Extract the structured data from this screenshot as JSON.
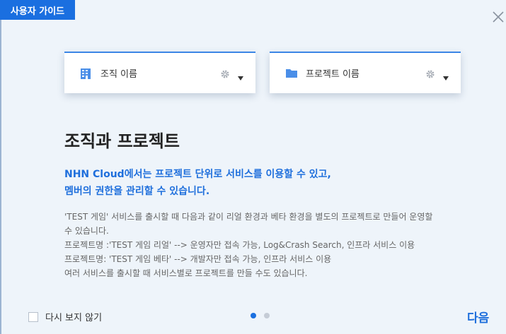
{
  "guide_tab": {
    "label": "사용자 가이드"
  },
  "cards": [
    {
      "label": "조직 이름",
      "icon": "building-icon"
    },
    {
      "label": "프로젝트 이름",
      "icon": "folder-icon"
    }
  ],
  "heading": "조직과 프로젝트",
  "lead": [
    "NHN Cloud에서는 프로젝트 단위로 서비스를 이용할 수 있고,",
    "멤버의 권한을 관리할 수 있습니다."
  ],
  "description": [
    "'TEST 게임' 서비스를 출시할 때 다음과 같이 리얼 환경과 베타 환경을 별도의 프로젝트로 만들어 운영할",
    "수 있습니다.",
    "프로젝트명 :'TEST 게임 리얼' --> 운영자만 접속 가능, Log&Crash Search, 인프라 서비스 이용",
    "프로젝트명: 'TEST 게임 베타' --> 개발자만 접속 가능, 인프라 서비스 이용",
    "여러 서비스를 출시할 때 서비스별로 프로젝트를 만들 수도 있습니다."
  ],
  "footer": {
    "dont_show_label": "다시 보지 않기",
    "next_label": "다음",
    "pagination": {
      "current": 1,
      "total": 2
    }
  },
  "colors": {
    "accent": "#1a6fe0",
    "background": "#eef4fa"
  }
}
